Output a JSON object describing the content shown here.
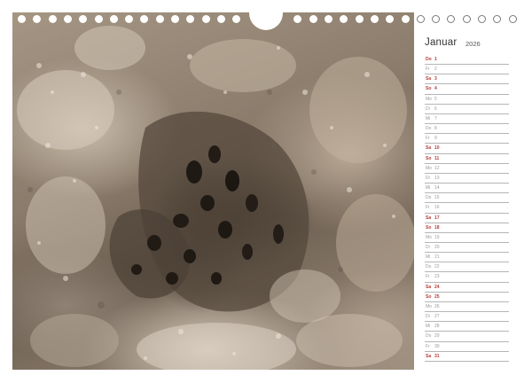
{
  "calendar": {
    "month": "Januar",
    "year": "2026",
    "days": [
      {
        "wd": "Do",
        "num": "1",
        "weekend": true
      },
      {
        "wd": "Fr",
        "num": "2",
        "weekend": false
      },
      {
        "wd": "Sa",
        "num": "3",
        "weekend": true
      },
      {
        "wd": "So",
        "num": "4",
        "weekend": true
      },
      {
        "wd": "Mo",
        "num": "5",
        "weekend": false
      },
      {
        "wd": "Di",
        "num": "6",
        "weekend": false
      },
      {
        "wd": "Mi",
        "num": "7",
        "weekend": false
      },
      {
        "wd": "Do",
        "num": "8",
        "weekend": false
      },
      {
        "wd": "Fr",
        "num": "9",
        "weekend": false
      },
      {
        "wd": "Sa",
        "num": "10",
        "weekend": true
      },
      {
        "wd": "So",
        "num": "11",
        "weekend": true
      },
      {
        "wd": "Mo",
        "num": "12",
        "weekend": false
      },
      {
        "wd": "Di",
        "num": "13",
        "weekend": false
      },
      {
        "wd": "Mi",
        "num": "14",
        "weekend": false
      },
      {
        "wd": "Do",
        "num": "15",
        "weekend": false
      },
      {
        "wd": "Fr",
        "num": "16",
        "weekend": false
      },
      {
        "wd": "Sa",
        "num": "17",
        "weekend": true
      },
      {
        "wd": "So",
        "num": "18",
        "weekend": true
      },
      {
        "wd": "Mo",
        "num": "19",
        "weekend": false
      },
      {
        "wd": "Di",
        "num": "20",
        "weekend": false
      },
      {
        "wd": "Mi",
        "num": "21",
        "weekend": false
      },
      {
        "wd": "Do",
        "num": "22",
        "weekend": false
      },
      {
        "wd": "Fr",
        "num": "23",
        "weekend": false
      },
      {
        "wd": "Sa",
        "num": "24",
        "weekend": true
      },
      {
        "wd": "So",
        "num": "25",
        "weekend": true
      },
      {
        "wd": "Mo",
        "num": "26",
        "weekend": false
      },
      {
        "wd": "Di",
        "num": "27",
        "weekend": false
      },
      {
        "wd": "Mi",
        "num": "28",
        "weekend": false
      },
      {
        "wd": "Do",
        "num": "29",
        "weekend": false
      },
      {
        "wd": "Fr",
        "num": "30",
        "weekend": false
      },
      {
        "wd": "Sa",
        "num": "31",
        "weekend": true
      }
    ]
  },
  "colors": {
    "weekend": "#b83a3a",
    "weekday": "#9a9a9a"
  }
}
